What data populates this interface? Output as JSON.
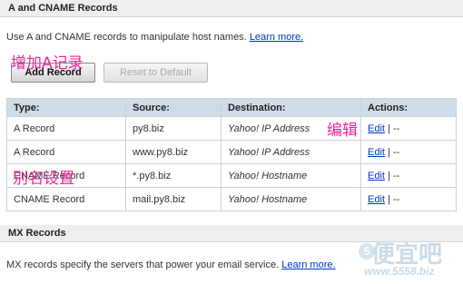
{
  "a_cname": {
    "title": "A and CNAME Records",
    "description": "Use A and CNAME records to manipulate host names.",
    "learn_more": "Learn more.",
    "add_button": "Add Record",
    "reset_button": "Reset to Default",
    "columns": [
      "Type:",
      "Source:",
      "Destination:",
      "Actions:"
    ],
    "rows": [
      {
        "type": "A Record",
        "source": "py8.biz",
        "destination": "Yahoo! IP Address",
        "edit": "Edit",
        "sep": " | --"
      },
      {
        "type": "A Record",
        "source": "www.py8.biz",
        "destination": "Yahoo! IP Address",
        "edit": "Edit",
        "sep": " | --"
      },
      {
        "type": "CNAME Record",
        "source": "*.py8.biz",
        "destination": "Yahoo! Hostname",
        "edit": "Edit",
        "sep": " | --"
      },
      {
        "type": "CNAME Record",
        "source": "mail.py8.biz",
        "destination": "Yahoo! Hostname",
        "edit": "Edit",
        "sep": " | --"
      }
    ]
  },
  "mx": {
    "title": "MX Records",
    "description": "MX records specify the servers that power your email service.",
    "learn_more": "Learn more."
  },
  "annotations": {
    "add_a_record": "增加A记录",
    "edit": "编辑",
    "alias_setup": "别名设置"
  },
  "watermark": {
    "badge": "5",
    "text": "便宜吧",
    "url": "www.5558.biz"
  },
  "colors": {
    "link": "#0033cc",
    "annotation": "#e8289a",
    "table_header": "#cfdce8",
    "section_bar": "#eeeeee"
  }
}
